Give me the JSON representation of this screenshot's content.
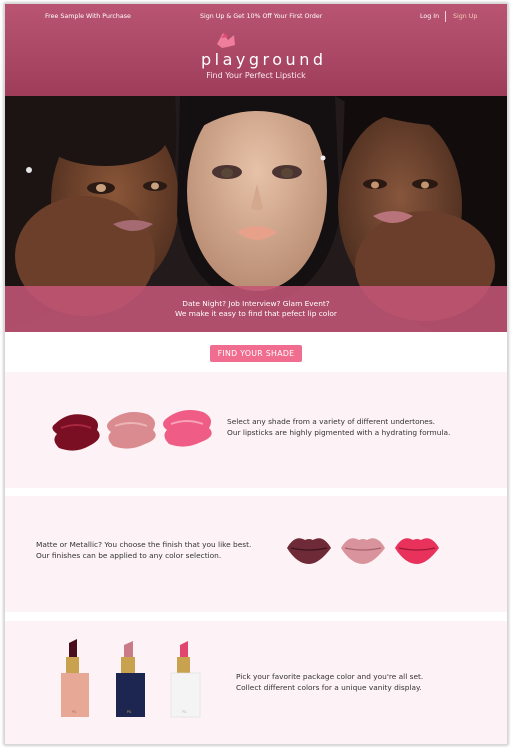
{
  "topbar": {
    "sample": "Free Sample With Purchase",
    "offer": "Sign Up & Get 10% Off Your First Order",
    "login": "Log In",
    "signup": "Sign Up"
  },
  "brand": {
    "name": "playground",
    "tagline": "Find Your Perfect Lipstick",
    "primary_color": "#a9476a",
    "accent_color": "#f06d8f"
  },
  "hero": {
    "line1": "Date Night? Job Interview? Glam Event?",
    "line2": "We make it easy to find that pefect lip color"
  },
  "cta": {
    "label": "FIND YOUR SHADE"
  },
  "features": [
    {
      "line1": "Select any shade from a variety of different undertones.",
      "line2": "Our lipsticks are highly pigmented with a hydrating formula.",
      "image": "lipstick-swatches-icon",
      "swatch_colors": [
        "#7a0e22",
        "#d98b8f",
        "#ef5d86"
      ]
    },
    {
      "line1": "Matte or Metallic? You choose the finish that you like best.",
      "line2": "Our finishes can be applied to any color selection.",
      "image": "lips-icon",
      "lip_colors": [
        "#6e2a36",
        "#d9939c",
        "#e8325c"
      ]
    },
    {
      "line1": "Pick your favorite package color and you're all set.",
      "line2": "Collect different colors for a unique vanity display.",
      "image": "lipstick-tubes-icon",
      "package_colors": [
        "#e8a896",
        "#1c2650",
        "#f4f4f4"
      ],
      "bullet_colors": [
        "#4a0e1c",
        "#c97c88",
        "#e1466f"
      ],
      "package_mark": "PG"
    }
  ]
}
